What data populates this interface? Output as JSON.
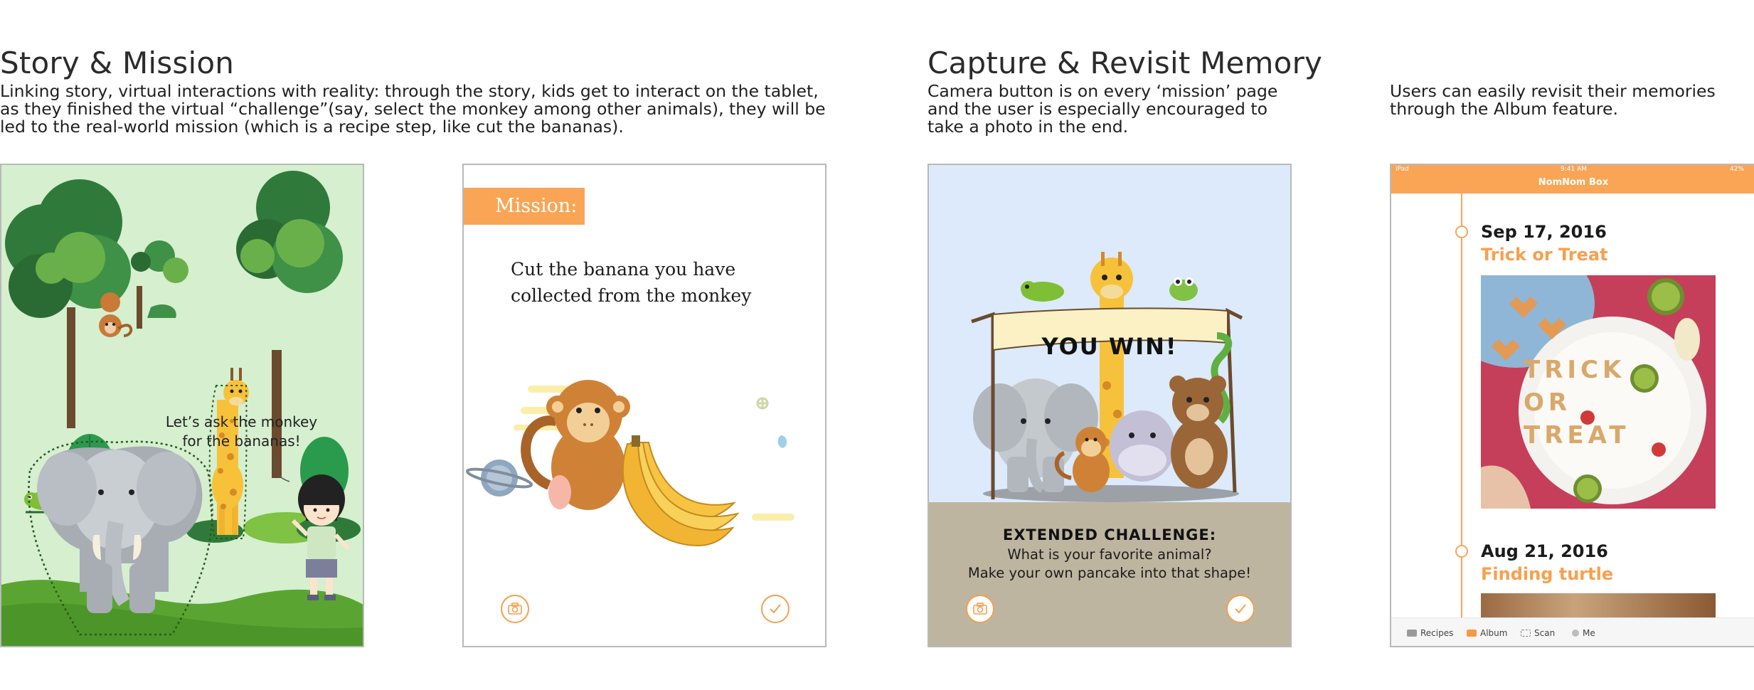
{
  "sections": {
    "story": {
      "heading": "Story & Mission",
      "desc": [
        "Linking story, virtual interactions with reality: through the story, kids get to interact on the tablet,",
        "as they finished the virtual “challenge”(say, select the monkey among other animals), they will be",
        "led to the real-world mission (which is a recipe step, like cut the bananas)."
      ]
    },
    "capture": {
      "heading": "Capture & Revisit Memory",
      "desc": [
        "Camera button is on every ‘mission’ page",
        "and the user is especially encouraged to",
        "take a photo in the end."
      ]
    },
    "album": {
      "desc": [
        "Users can easily revisit their memories",
        "through the Album feature."
      ]
    }
  },
  "story_panel": {
    "speech": [
      "Let’s ask the monkey",
      "for the bananas!"
    ]
  },
  "mission_panel": {
    "tag": "Mission:",
    "text": [
      "Cut the banana you have",
      "collected from the monkey"
    ]
  },
  "win_panel": {
    "banner": "YOU WIN!",
    "ext_title": "EXTENDED CHALLENGE:",
    "ext_lines": [
      "What is your favorite animal?",
      "Make your own pancake into that shape!"
    ]
  },
  "album_panel": {
    "status": {
      "left": "iPad",
      "time": "9:41 AM",
      "battery": "42%"
    },
    "app_title": "NomNom Box",
    "entries": [
      {
        "date": "Sep 17, 2016",
        "title": "Trick or Treat",
        "photo_letters": [
          "T",
          "R",
          "I",
          "C",
          "K",
          "O",
          "R",
          "T",
          "R",
          "E",
          "A",
          "T"
        ]
      },
      {
        "date": "Aug 21, 2016",
        "title": "Finding turtle"
      }
    ],
    "tabs": [
      {
        "label": "Recipes",
        "icon": "recipes-icon"
      },
      {
        "label": "Album",
        "icon": "album-icon"
      },
      {
        "label": "Scan",
        "icon": "scan-icon"
      },
      {
        "label": "Me",
        "icon": "me-icon"
      }
    ]
  },
  "colors": {
    "accent": "#f9a555",
    "story_bg": "#d5efcf",
    "sky": "#dceafb",
    "ground": "#beb5a1"
  }
}
